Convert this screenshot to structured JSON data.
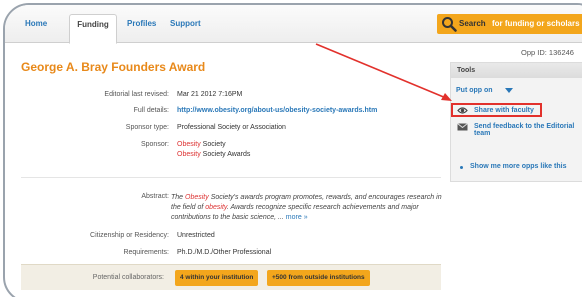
{
  "nav": {
    "items": [
      "Home",
      "Funding",
      "Profiles",
      "Support"
    ],
    "active": "Funding",
    "search_label": "Search",
    "search_hint": "for funding or scholars"
  },
  "opp_id": "Opp ID: 136246",
  "title": "George A. Bray Founders Award",
  "fields": {
    "revised_label": "Editorial last revised:",
    "revised_value": "Mar 21 2012 7:16PM",
    "details_label": "Full details:",
    "details_value": "http://www.obesity.org/about-us/obesity-society-awards.htm",
    "sponsor_type_label": "Sponsor type:",
    "sponsor_type_value": "Professional Society or Association",
    "sponsor_label": "Sponsor:",
    "sponsor_line1_kw": "Obesity",
    "sponsor_line1_rest": " Society",
    "sponsor_line2_kw": "Obesity",
    "sponsor_line2_rest": " Society Awards",
    "abstract_label": "Abstract:",
    "abstract_the": "The ",
    "abstract_kw1": "Obesity",
    "abstract_mid": " Society's awards program promotes, rewards, and encourages research in the field of ",
    "abstract_kw2": "obesity",
    "abstract_end": ". Awards recognize specific research achievements and major contributions to the basic science, ... ",
    "abstract_more": "more »",
    "citizenship_label": "Citizenship or Residency:",
    "citizenship_value": "Unrestricted",
    "requirements_label": "Requirements:",
    "requirements_value": "Ph.D./M.D./Other Professional",
    "collab_label": "Potential collaborators:",
    "collab_inside": "4 within your institution",
    "collab_outside": "+500 from outside institutions"
  },
  "tools": {
    "heading": "Tools",
    "put_opp_on": "Put opp on",
    "share": "Share with faculty",
    "feedback_line1": "Send feedback to the Editorial",
    "feedback_line2": "team",
    "show_more": "Show me more opps like this"
  },
  "colors": {
    "accent_orange": "#f3a61c",
    "title_orange": "#e8891a",
    "link_blue": "#2a78b8",
    "highlight_red": "#e2312c",
    "keyword_red": "#d33"
  }
}
